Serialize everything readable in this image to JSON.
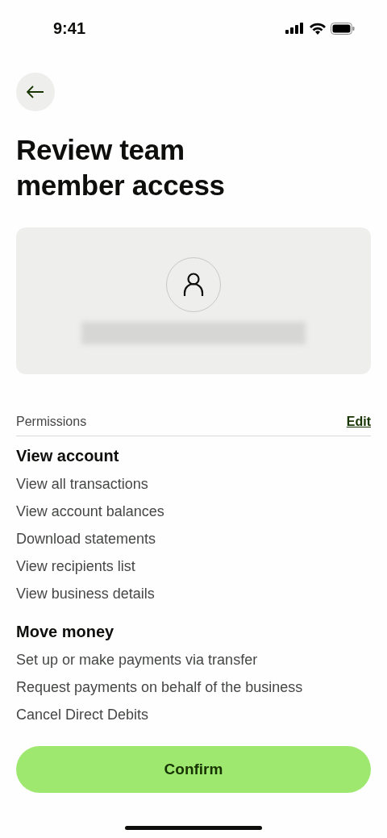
{
  "status_bar": {
    "time": "9:41"
  },
  "title": "Review team member access",
  "member_card": {
    "kind": "redacted_email"
  },
  "permissions": {
    "label": "Permissions",
    "edit": "Edit",
    "sections": [
      {
        "heading": "View account",
        "items": [
          "View all transactions",
          "View account balances",
          "Download statements",
          "View recipients list",
          "View business details"
        ]
      },
      {
        "heading": "Move money",
        "items": [
          "Set up or make payments via transfer",
          "Request payments on behalf of the business",
          "Cancel Direct Debits"
        ]
      }
    ]
  },
  "confirm_button": "Confirm"
}
